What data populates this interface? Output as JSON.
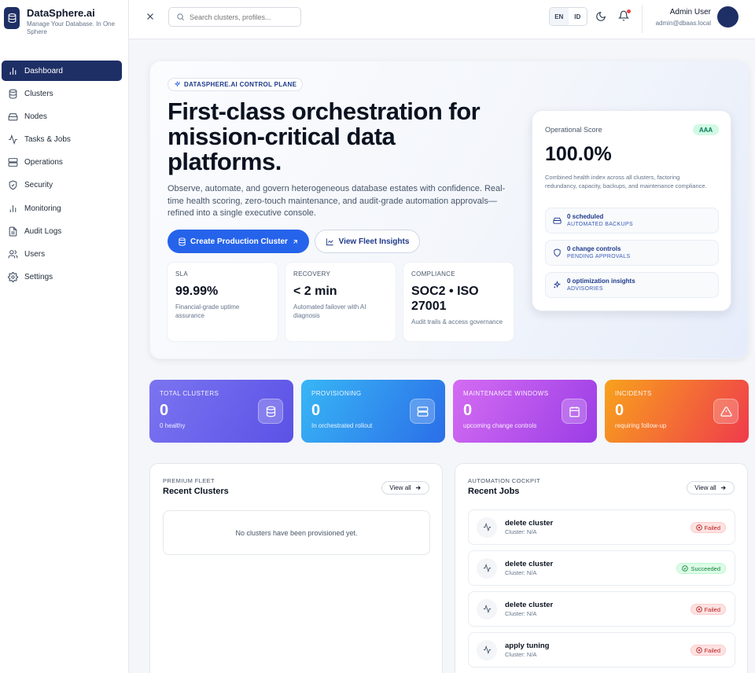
{
  "brand": {
    "name": "DataSphere.ai",
    "tagline": "Manage Your Database. In One Sphere"
  },
  "nav": [
    {
      "label": "Dashboard",
      "icon": "bar-chart-icon",
      "active": true
    },
    {
      "label": "Clusters",
      "icon": "database-icon"
    },
    {
      "label": "Nodes",
      "icon": "hard-drive-icon"
    },
    {
      "label": "Tasks & Jobs",
      "icon": "activity-icon"
    },
    {
      "label": "Operations",
      "icon": "server-icon"
    },
    {
      "label": "Security",
      "icon": "shield-icon"
    },
    {
      "label": "Monitoring",
      "icon": "bar-chart-icon"
    },
    {
      "label": "Audit Logs",
      "icon": "file-text-icon"
    },
    {
      "label": "Users",
      "icon": "users-icon"
    },
    {
      "label": "Settings",
      "icon": "gear-icon"
    }
  ],
  "topbar": {
    "search_placeholder": "Search clusters, profiles...",
    "languages": [
      "EN",
      "ID"
    ],
    "selected_language": "EN",
    "user_name": "Admin User",
    "user_email": "admin@dbaas.local"
  },
  "hero": {
    "chip": "DATASPHERE.AI CONTROL PLANE",
    "title": "First-class orchestration for mission-critical data platforms.",
    "description": "Observe, automate, and govern heterogeneous database estates with confidence. Real-time health scoring, zero-touch maintenance, and audit-grade automation approvals—refined into a single executive console.",
    "primary_button": "Create Production Cluster",
    "secondary_button": "View Fleet Insights",
    "metrics": [
      {
        "label": "SLA",
        "value": "99.99%",
        "note": "Financial-grade uptime assurance"
      },
      {
        "label": "RECOVERY",
        "value": "< 2 min",
        "note": "Automated failover with AI diagnosis"
      },
      {
        "label": "COMPLIANCE",
        "value": "SOC2 • ISO 27001",
        "note": "Audit trails & access governance"
      }
    ]
  },
  "score": {
    "label": "Operational Score",
    "badge": "AAA",
    "value": "100.0%",
    "description": "Combined health index across all clusters, factoring redundancy, capacity, backups, and maintenance compliance.",
    "items": [
      {
        "title": "0 scheduled",
        "sub": "AUTOMATED BACKUPS",
        "icon": "hard-drive-icon"
      },
      {
        "title": "0 change controls",
        "sub": "PENDING APPROVALS",
        "icon": "shield-icon"
      },
      {
        "title": "0 optimization insights",
        "sub": "ADVISORIES",
        "icon": "sparkles-icon"
      }
    ]
  },
  "stats": [
    {
      "label": "TOTAL CLUSTERS",
      "value": "0",
      "note": "0 healthy",
      "icon": "database-icon"
    },
    {
      "label": "PROVISIONING",
      "value": "0",
      "note": "In orchestrated rollout",
      "icon": "server-icon"
    },
    {
      "label": "MAINTENANCE WINDOWS",
      "value": "0",
      "note": "upcoming change controls",
      "icon": "calendar-icon"
    },
    {
      "label": "INCIDENTS",
      "value": "0",
      "note": "requiring follow-up",
      "icon": "alert-triangle-icon"
    }
  ],
  "colors": {
    "stat_gradients": [
      [
        "#7b74f0",
        "#5b52e6"
      ],
      [
        "#38b6f5",
        "#2b6ee8"
      ],
      [
        "#d46cf2",
        "#9b3de6"
      ],
      [
        "#f8a21c",
        "#ef3b4c"
      ]
    ]
  },
  "recent_clusters": {
    "eyebrow": "PREMIUM FLEET",
    "title": "Recent Clusters",
    "view_all": "View all",
    "empty": "No clusters have been provisioned yet."
  },
  "recent_jobs": {
    "eyebrow": "AUTOMATION COCKPIT",
    "title": "Recent Jobs",
    "view_all": "View all",
    "jobs": [
      {
        "title": "delete cluster",
        "sub": "Cluster: N/A",
        "status": "Failed"
      },
      {
        "title": "delete cluster",
        "sub": "Cluster: N/A",
        "status": "Succeeded"
      },
      {
        "title": "delete cluster",
        "sub": "Cluster: N/A",
        "status": "Failed"
      },
      {
        "title": "apply tuning",
        "sub": "Cluster: N/A",
        "status": "Failed"
      }
    ]
  }
}
